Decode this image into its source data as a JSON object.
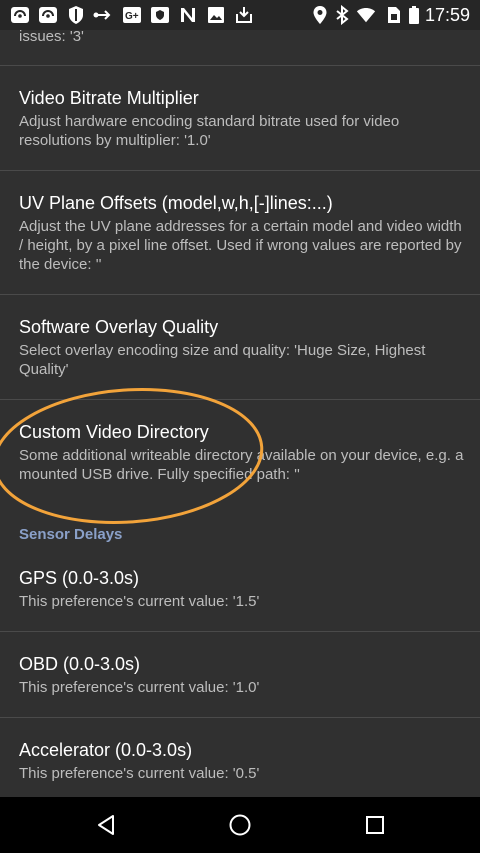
{
  "statusbar": {
    "time": "17:59"
  },
  "partial": {
    "summary_tail": "issues: '3'"
  },
  "prefs": [
    {
      "title": "Video Bitrate Multiplier",
      "summary": "Adjust hardware encoding standard bitrate used for video resolutions by multiplier: '1.0'"
    },
    {
      "title": "UV Plane Offsets (model,w,h,[-]lines:...)",
      "summary": "Adjust the UV plane addresses for a certain model and video width / height, by a pixel line offset. Used if wrong values are reported by the device: ''"
    },
    {
      "title": "Software Overlay Quality",
      "summary": "Select overlay encoding size and quality: 'Huge Size, Highest Quality'"
    },
    {
      "title": "Custom Video Directory",
      "summary": "Some additional writeable directory available on your device, e.g. a mounted USB drive. Fully specified path: ''"
    }
  ],
  "category": {
    "label": "Sensor Delays"
  },
  "sensors": [
    {
      "title": "GPS (0.0-3.0s)",
      "summary": "This preference's current value: '1.5'"
    },
    {
      "title": "OBD (0.0-3.0s)",
      "summary": "This preference's current value: '1.0'"
    },
    {
      "title": "Accelerator (0.0-3.0s)",
      "summary": "This preference's current value: '0.5'"
    }
  ],
  "colors": {
    "highlight": "#f2a33a",
    "category": "#8aa0c8"
  }
}
